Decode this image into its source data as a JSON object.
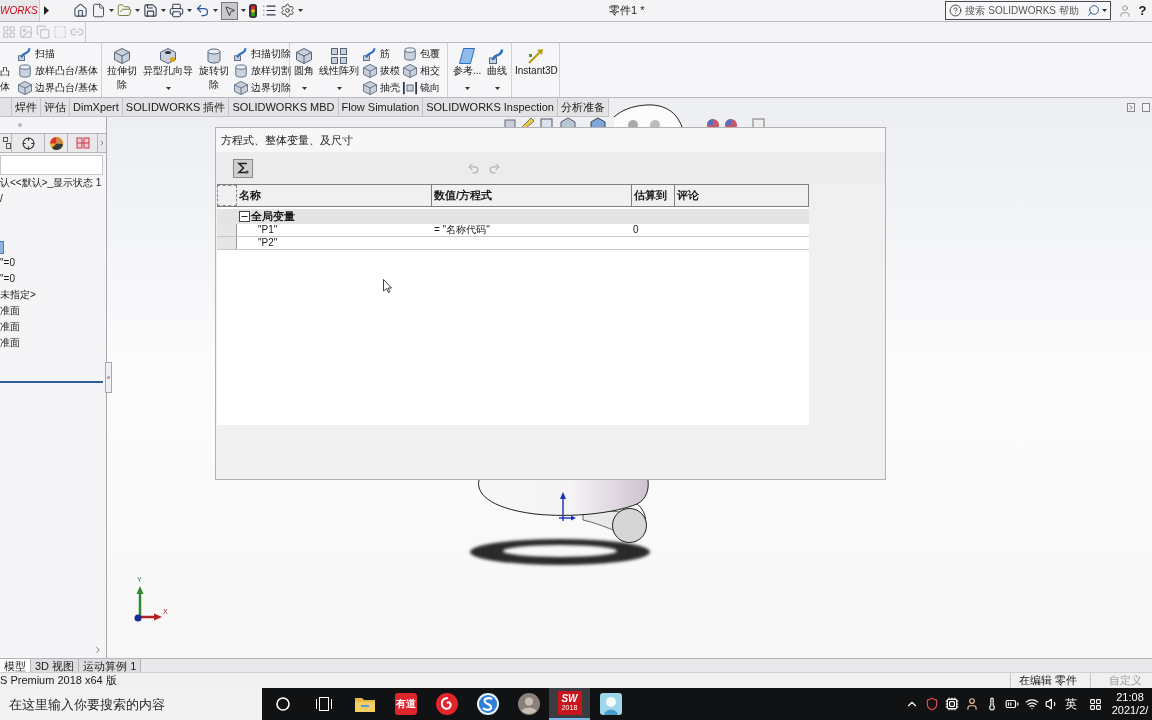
{
  "title_bar": {
    "logo": "WORKS",
    "select_tool_selected": true,
    "title": "零件1 *",
    "search": {
      "placeholder": "搜索 SOLIDWORKS 帮助"
    },
    "help": "?"
  },
  "ribbon": {
    "groups": [
      {
        "items": [
          {
            "kind": "partial",
            "lines": [
              "凸",
              "体"
            ]
          },
          {
            "kind": "stack",
            "labels": [
              "扫描",
              "放样凸台/基体",
              "边界凸台/基体"
            ]
          }
        ]
      },
      {
        "items": [
          {
            "kind": "large",
            "label": "拉伸切除",
            "dropdown": false
          },
          {
            "kind": "large",
            "label": "异型孔向导",
            "dropdown": true
          },
          {
            "kind": "large",
            "label": "旋转切除",
            "dropdown": false
          },
          {
            "kind": "stack",
            "labels": [
              "扫描切除",
              "放样切割",
              "边界切除"
            ]
          }
        ]
      },
      {
        "items": [
          {
            "kind": "large",
            "label": "圆角",
            "dropdown": true
          },
          {
            "kind": "large",
            "label": "线性阵列",
            "dropdown": true
          },
          {
            "kind": "stack",
            "labels": [
              "筋",
              "拔模",
              "抽壳"
            ]
          },
          {
            "kind": "stack",
            "labels": [
              "包覆",
              "相交",
              "镜向"
            ]
          }
        ]
      },
      {
        "items": [
          {
            "kind": "large",
            "label": "参考...",
            "dropdown": true
          },
          {
            "kind": "large",
            "label": "曲线",
            "dropdown": true
          }
        ]
      },
      {
        "items": [
          {
            "kind": "large",
            "label": "Instant3D",
            "dropdown": false
          }
        ]
      }
    ]
  },
  "tabs": [
    {
      "label": "焊件"
    },
    {
      "label": "评估"
    },
    {
      "label": "DimXpert"
    },
    {
      "label": "SOLIDWORKS 插件"
    },
    {
      "label": "SOLIDWORKS MBD"
    },
    {
      "label": "Flow Simulation"
    },
    {
      "label": "SOLIDWORKS Inspection"
    },
    {
      "label": "分析准备"
    }
  ],
  "feature_tree": {
    "items": [
      {
        "kind": "text",
        "label": "认<<默认>_显示状态 1"
      },
      {
        "kind": "text",
        "label": "/"
      },
      {
        "kind": "icon"
      },
      {
        "kind": "text",
        "label": "\"=0"
      },
      {
        "kind": "text",
        "label": "\"=0"
      },
      {
        "kind": "text",
        "label": "未指定>"
      },
      {
        "kind": "text",
        "label": "准面"
      },
      {
        "kind": "text",
        "label": "准面"
      },
      {
        "kind": "text",
        "label": "准面"
      }
    ]
  },
  "dialog": {
    "title": "方程式、整体变量、及尺寸",
    "toolbar": {
      "sum_selected": true,
      "undo_disabled": true,
      "redo_disabled": true
    },
    "table": {
      "columns": [
        "名称",
        "数值/方程式",
        "估算到",
        "评论"
      ],
      "groups": [
        {
          "label": "全局变量",
          "expanded": true,
          "rows": [
            {
              "name": "\"P1\"",
              "value": "= \"名称代码\"",
              "evaluates_to": "0"
            },
            {
              "name": "\"P2\""
            }
          ]
        }
      ]
    }
  },
  "triad": {
    "y_label": "Y",
    "x_label": "X"
  },
  "bottom_tabs": [
    {
      "label": "模型",
      "selected": true
    },
    {
      "label": "3D 视图",
      "selected": false
    },
    {
      "label": "运动算例 1",
      "selected": false
    }
  ],
  "status_bar": {
    "product": "S Premium 2018 x64 版",
    "mode": "在编辑 零件",
    "units": "自定义"
  },
  "taskbar": {
    "search": {
      "placeholder": "在这里输入你要搜索的内容"
    },
    "apps": [
      {
        "kind": "folder",
        "selected": false
      },
      {
        "kind": "tile",
        "label": "有道",
        "selected": false
      },
      {
        "kind": "swirl",
        "selected": false
      },
      {
        "kind": "swoosh",
        "selected": false
      },
      {
        "kind": "avatar",
        "selected": false
      },
      {
        "kind": "badge",
        "label": "SW",
        "sublabel": "2018",
        "selected": true
      },
      {
        "kind": "picture",
        "selected": false
      }
    ],
    "tray": {
      "language": "英",
      "time": "21:08",
      "date": "2021/2/"
    }
  }
}
